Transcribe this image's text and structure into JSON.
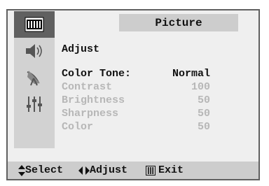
{
  "menu": {
    "title": "Picture",
    "heading": "Adjust",
    "items": [
      {
        "label": "Color Tone:",
        "value": "Normal"
      },
      {
        "label": "Contrast",
        "value": "100"
      },
      {
        "label": "Brightness",
        "value": "50"
      },
      {
        "label": "Sharpness",
        "value": "50"
      },
      {
        "label": "Color",
        "value": "50"
      }
    ]
  },
  "sidebar": {
    "icons": [
      "picture-icon",
      "sound-icon",
      "channel-icon",
      "setup-icon"
    ]
  },
  "footer": {
    "select": "Select",
    "adjust": "Adjust",
    "exit": "Exit"
  }
}
